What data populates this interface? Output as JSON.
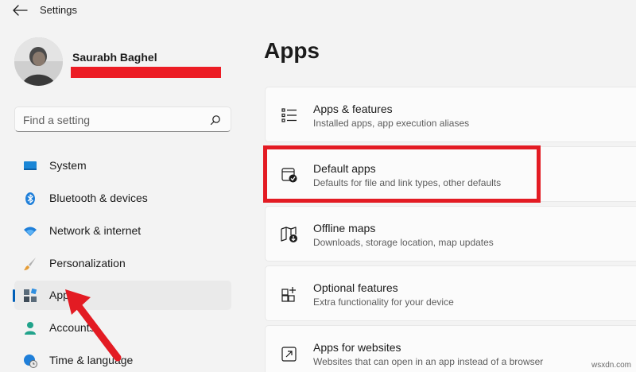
{
  "window": {
    "title": "Settings"
  },
  "profile": {
    "name": "Saurabh Baghel"
  },
  "search": {
    "placeholder": "Find a setting",
    "value": ""
  },
  "sidebar": {
    "items": [
      {
        "label": "System",
        "icon": "monitor-icon"
      },
      {
        "label": "Bluetooth & devices",
        "icon": "bluetooth-icon"
      },
      {
        "label": "Network & internet",
        "icon": "wifi-icon"
      },
      {
        "label": "Personalization",
        "icon": "brush-icon"
      },
      {
        "label": "Apps",
        "icon": "apps-icon",
        "selected": true
      },
      {
        "label": "Accounts",
        "icon": "person-icon"
      },
      {
        "label": "Time & language",
        "icon": "globe-clock-icon"
      }
    ]
  },
  "main": {
    "title": "Apps",
    "cards": [
      {
        "title": "Apps & features",
        "subtitle": "Installed apps, app execution aliases",
        "icon": "list-icon"
      },
      {
        "title": "Default apps",
        "subtitle": "Defaults for file and link types, other defaults",
        "icon": "default-apps-icon"
      },
      {
        "title": "Offline maps",
        "subtitle": "Downloads, storage location, map updates",
        "icon": "map-download-icon"
      },
      {
        "title": "Optional features",
        "subtitle": "Extra functionality for your device",
        "icon": "grid-plus-icon"
      },
      {
        "title": "Apps for websites",
        "subtitle": "Websites that can open in an app instead of a browser",
        "icon": "open-external-icon"
      }
    ]
  },
  "annotations": {
    "highlight_color": "#e31b23",
    "accent": "#005fb8"
  },
  "watermark": "wsxdn.com"
}
